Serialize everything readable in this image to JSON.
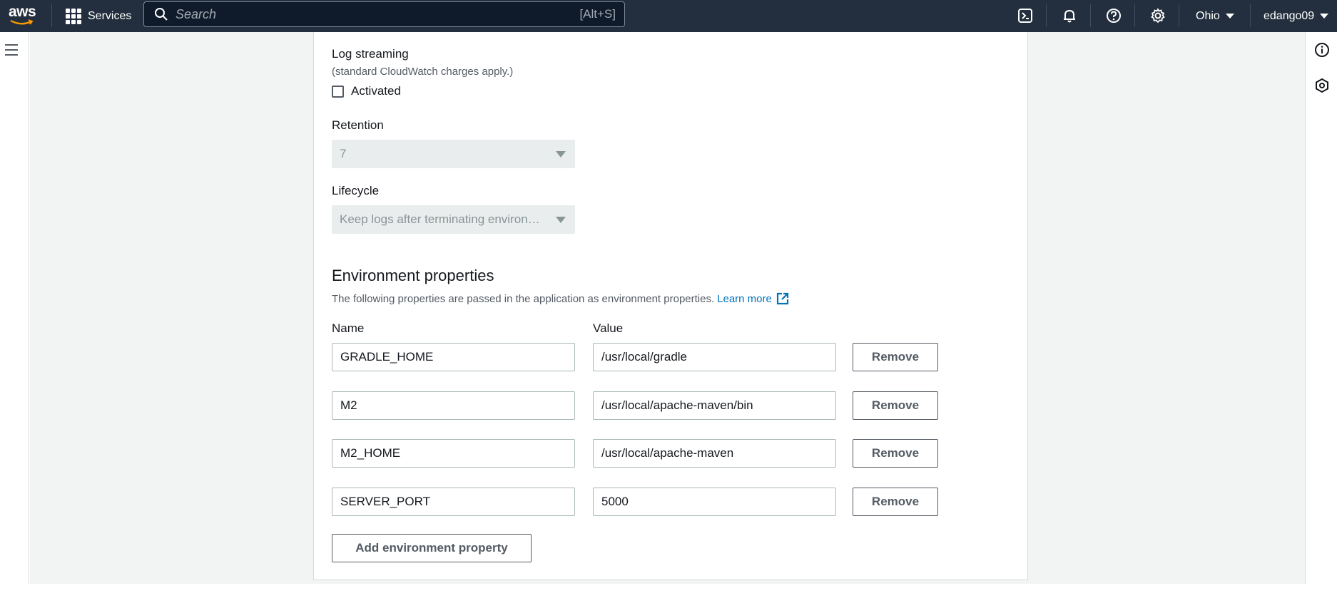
{
  "topnav": {
    "logo_text": "aws",
    "services_label": "Services",
    "search_placeholder": "Search",
    "search_shortcut": "[Alt+S]",
    "region": "Ohio",
    "user": "edango09",
    "icons": [
      "cloudshell-icon",
      "bell-icon",
      "help-icon",
      "gear-icon"
    ]
  },
  "log_streaming": {
    "label": "Log streaming",
    "note": "(standard CloudWatch charges apply.)",
    "checkbox_label": "Activated",
    "checked": false
  },
  "retention": {
    "label": "Retention",
    "value": "7"
  },
  "lifecycle": {
    "label": "Lifecycle",
    "value": "Keep logs after terminating environment"
  },
  "env_props": {
    "title": "Environment properties",
    "description": "The following properties are passed in the application as environment properties.",
    "learn_more": "Learn more",
    "name_header": "Name",
    "value_header": "Value",
    "rows": [
      {
        "name": "GRADLE_HOME",
        "value": "/usr/local/gradle",
        "remove": "Remove"
      },
      {
        "name": "M2",
        "value": "/usr/local/apache-maven/bin",
        "remove": "Remove"
      },
      {
        "name": "M2_HOME",
        "value": "/usr/local/apache-maven",
        "remove": "Remove"
      },
      {
        "name": "SERVER_PORT",
        "value": "5000",
        "remove": "Remove"
      }
    ],
    "add_label": "Add environment property"
  },
  "colors": {
    "nav_bg": "#232f3e",
    "link": "#0073bb",
    "page_bg": "#f2f3f3"
  }
}
